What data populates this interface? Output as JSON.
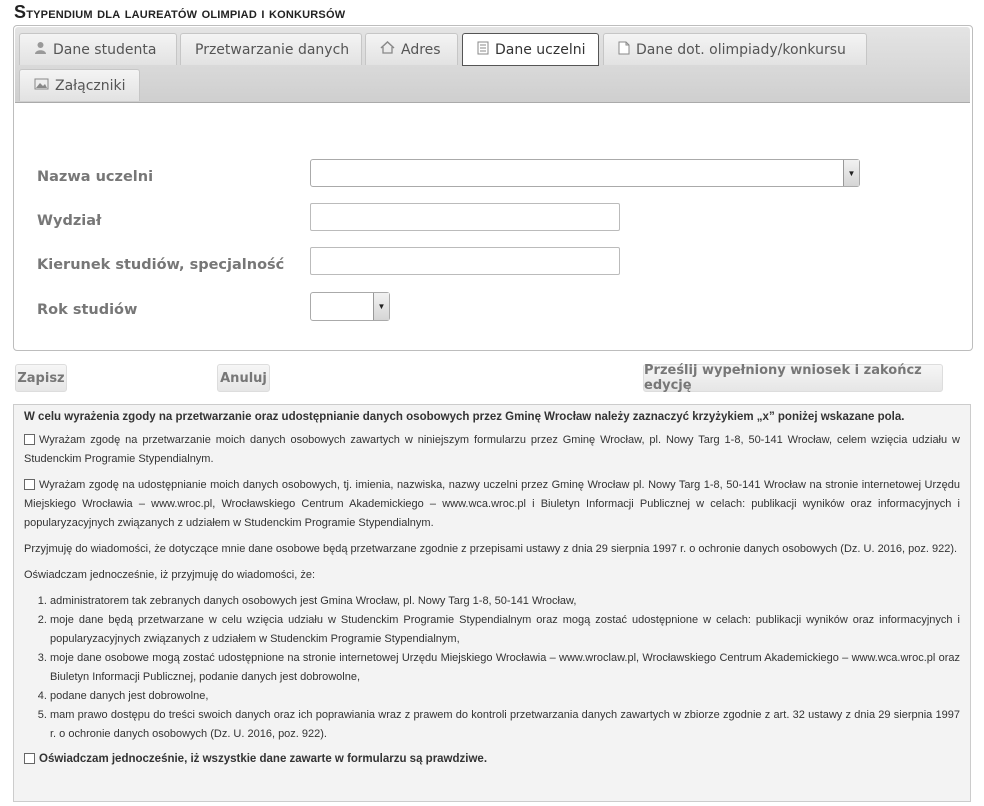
{
  "page": {
    "title_first": "S",
    "title_rest": "typendium dla laureatów olimpiad i konkursów"
  },
  "tabs": [
    {
      "label": "Dane studenta",
      "icon": "person-icon"
    },
    {
      "label": "Przetwarzanie danych",
      "icon": ""
    },
    {
      "label": "Adres",
      "icon": "home-icon"
    },
    {
      "label": "Dane uczelni",
      "icon": "document-icon",
      "active": true
    },
    {
      "label": "Dane dot. olimpiady/konkursu",
      "icon": "file-icon"
    },
    {
      "label": "Załączniki",
      "icon": "image-icon"
    }
  ],
  "form": {
    "university_label": "Nazwa uczelni",
    "university_value": "",
    "faculty_label": "Wydział",
    "faculty_value": "",
    "field_label": "Kierunek studiów, specjalność",
    "field_value": "",
    "year_label": "Rok studiów",
    "year_value": ""
  },
  "buttons": {
    "save": "Zapisz",
    "cancel": "Anuluj",
    "submit": "Prześlij wypełniony wniosek i zakończ edycję"
  },
  "consent": {
    "heading": "W celu wyrażenia zgody na przetwarzanie oraz udostępnianie danych osobowych przez Gminę Wrocław należy zaznaczyć krzyżykiem „x” poniżej wskazane pola.",
    "consent1": "Wyrażam zgodę na przetwarzanie moich danych osobowych zawartych w niniejszym formularzu przez Gminę Wrocław, pl. Nowy Targ 1-8, 50-141 Wrocław, celem wzięcia udziału w Studenckim Programie Stypendialnym.",
    "consent2": "Wyrażam zgodę na udostępnianie moich danych osobowych, tj. imienia, nazwiska, nazwy uczelni przez Gminę Wrocław pl. Nowy Targ 1-8, 50-141 Wrocław na stronie internetowej Urzędu Miejskiego Wrocławia – www.wroc.pl, Wrocławskiego Centrum Akademickiego – www.wca.wroc.pl i Biuletyn Informacji Publicznej w celach: publikacji wyników oraz informacyjnych i popularyzacyjnych związanych z udziałem w Studenckim Programie Stypendialnym.",
    "info1": "Przyjmuję do wiadomości, że dotyczące mnie dane osobowe będą przetwarzane zgodnie z przepisami ustawy z dnia 29 sierpnia 1997 r. o ochronie danych osobowych (Dz. U. 2016, poz. 922).",
    "info2": "Oświadczam jednocześnie, iż przyjmuję do wiadomości, że:",
    "list": [
      "administratorem tak zebranych danych osobowych jest Gmina Wrocław, pl. Nowy Targ 1-8, 50-141 Wrocław,",
      "moje dane będą przetwarzane w celu wzięcia udziału w Studenckim Programie Stypendialnym oraz mogą zostać udostępnione w celach: publikacji wyników oraz informacyjnych i popularyzacyjnych związanych z udziałem w Studenckim Programie Stypendialnym,",
      "moje dane osobowe mogą zostać udostępnione na stronie internetowej Urzędu Miejskiego Wrocławia – www.wroclaw.pl, Wrocławskiego Centrum Akademickiego – www.wca.wroc.pl oraz Biuletyn Informacji Publicznej, podanie danych jest dobrowolne,",
      "podane danych jest dobrowolne,",
      "mam prawo dostępu do treści swoich danych oraz ich poprawiania wraz z prawem do kontroli przetwarzania danych zawartych w zbiorze zgodnie z art. 32 ustawy z dnia 29 sierpnia 1997 r. o ochronie danych osobowych (Dz. U. 2016, poz. 922)."
    ],
    "final": "Oświadczam jednocześnie, iż wszystkie dane zawarte w formularzu są prawdziwe."
  }
}
